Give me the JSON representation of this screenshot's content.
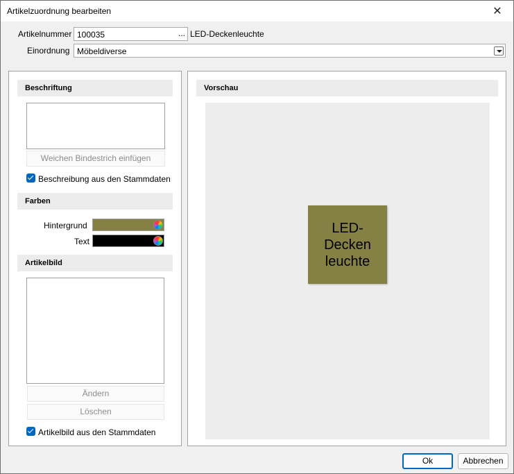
{
  "window": {
    "title": "Artikelzuordnung bearbeiten",
    "close_glyph": "✕"
  },
  "artikelnummer": {
    "label": "Artikelnummer",
    "value": "100035",
    "browse_glyph": "...",
    "description": "LED-Deckenleuchte"
  },
  "einordnung": {
    "label": "Einordnung",
    "value": "Möbeldiverse"
  },
  "beschriftung": {
    "header": "Beschriftung",
    "text": "",
    "hyphen_button": "Weichen Bindestrich einfügen",
    "checkbox_label": "Beschreibung aus den Stammdaten",
    "checked": true
  },
  "farben": {
    "header": "Farben",
    "background_label": "Hintergrund",
    "background_color": "#858145",
    "text_label": "Text",
    "text_color": "#000000"
  },
  "artikelbild": {
    "header": "Artikelbild",
    "change_button": "Ändern",
    "delete_button": "Löschen",
    "checkbox_label": "Artikelbild aus den Stammdaten",
    "checked": true
  },
  "vorschau": {
    "header": "Vorschau",
    "tile_text": "LED-\nDecken\nleuchte"
  },
  "buttons": {
    "ok": "Ok",
    "cancel": "Abbrechen"
  },
  "colors": {
    "accent": "#0067c0"
  }
}
